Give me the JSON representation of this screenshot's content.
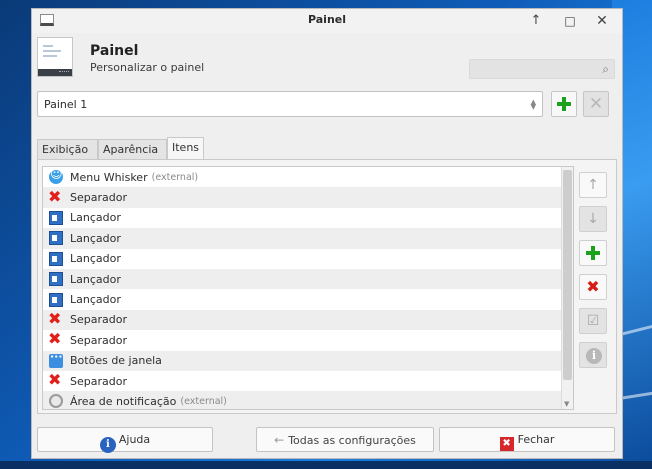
{
  "window": {
    "title": "Painel",
    "controls": {
      "up": "↑",
      "maximize": "□",
      "close": "✕"
    }
  },
  "header": {
    "title": "Painel",
    "subtitle": "Personalizar o painel",
    "search": {
      "value": "",
      "placeholder": "",
      "icon": "search-icon"
    }
  },
  "panel_selector": {
    "value": "Painel 1",
    "add_icon": "plus-icon",
    "remove_icon": "x-icon"
  },
  "tabs": [
    {
      "label": "Exibição",
      "active": false
    },
    {
      "label": "Aparência",
      "active": false
    },
    {
      "label": "Itens",
      "active": true
    }
  ],
  "items": [
    {
      "label": "Menu Whisker",
      "extra": "(external)",
      "icon": "whisker-icon"
    },
    {
      "label": "Separador",
      "extra": "",
      "icon": "separator-x-icon"
    },
    {
      "label": "Lançador",
      "extra": "",
      "icon": "launcher-icon"
    },
    {
      "label": "Lançador",
      "extra": "",
      "icon": "launcher-icon"
    },
    {
      "label": "Lançador",
      "extra": "",
      "icon": "launcher-icon"
    },
    {
      "label": "Lançador",
      "extra": "",
      "icon": "launcher-icon"
    },
    {
      "label": "Lançador",
      "extra": "",
      "icon": "launcher-icon"
    },
    {
      "label": "Separador",
      "extra": "",
      "icon": "separator-x-icon"
    },
    {
      "label": "Separador",
      "extra": "",
      "icon": "separator-x-icon"
    },
    {
      "label": "Botões de janela",
      "extra": "",
      "icon": "window-buttons-icon"
    },
    {
      "label": "Separador",
      "extra": "",
      "icon": "separator-x-icon"
    },
    {
      "label": "Área de notificação",
      "extra": "(external)",
      "icon": "notification-area-icon"
    }
  ],
  "side_buttons": {
    "move_up": "↑",
    "move_down": "↓",
    "add": "plus-icon",
    "remove": "✖",
    "edit": "☑",
    "about": "i"
  },
  "footer": {
    "help": "Ajuda",
    "help_icon": "i",
    "all_settings": "Todas as configurações",
    "all_settings_arrow": "←",
    "close": "Fechar",
    "close_icon": "✖"
  },
  "colors": {
    "add_green": "#1aa31a",
    "remove_red": "#d61e17",
    "launcher_blue": "#2f6fc4",
    "desktop_blue": "#0f5cb8"
  }
}
